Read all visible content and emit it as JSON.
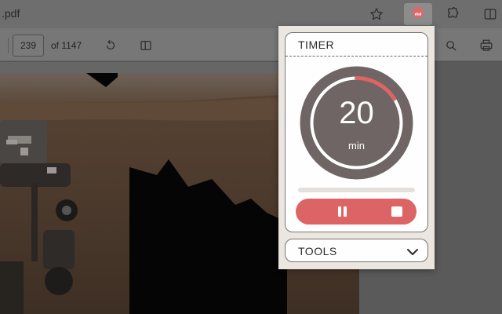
{
  "browser": {
    "tab_title": ".pdf",
    "page_current": "239",
    "page_total_text": "of 1147"
  },
  "popup": {
    "timer_title": "TIMER",
    "timer_value": "20",
    "timer_unit": "min",
    "timer_progress_fraction": 0.0,
    "dial_arc_fraction": 0.16,
    "tools_title": "TOOLS",
    "colors": {
      "accent": "#dc6464",
      "dial": "#6e6564",
      "card_border": "#7a7472",
      "popup_bg": "#ece6e1"
    }
  },
  "icons": {
    "favorite": "star-icon",
    "extension_active": "timer-extension-icon",
    "extensions": "puzzle-icon",
    "split": "split-screen-icon",
    "rotate": "rotate-icon",
    "page_view": "page-view-icon",
    "search": "search-icon",
    "print": "print-icon",
    "pause": "pause-icon",
    "stop": "stop-icon",
    "expand": "chevron-down-icon"
  }
}
